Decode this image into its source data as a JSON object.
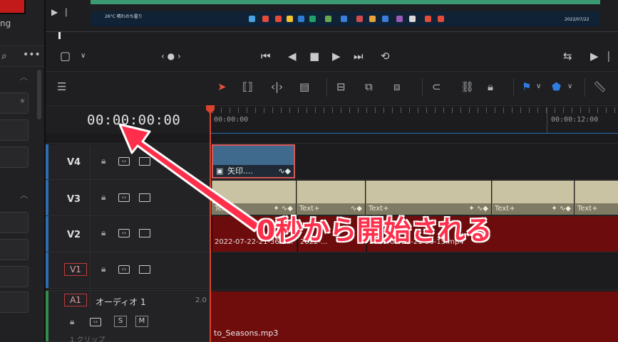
{
  "left_panel": {
    "label": "ng"
  },
  "viewer": {
    "timecode": "00:00:00:00",
    "taskbar_text": "26°C 晴れのち曇り",
    "clock": "2022/07/22"
  },
  "ruler": {
    "start": "00:00:00",
    "mark": "00:00:12:00"
  },
  "tracks": {
    "v4": {
      "name": "V4"
    },
    "v3": {
      "name": "V3"
    },
    "v2": {
      "name": "V2"
    },
    "v1": {
      "name": "V1"
    },
    "a1": {
      "name": "A1",
      "title": "オーディオ 1",
      "level": "2.0",
      "clips": "1 クリップ",
      "solo": "S",
      "mute": "M"
    }
  },
  "clips": {
    "v4_label": "矢印....",
    "v3_labels": [
      "Text+",
      "Text+",
      "Text+",
      "Text+",
      "Text+",
      "Text+"
    ],
    "v2_labels": [
      "2022-07-22-21-36-1...",
      "2022-...",
      "2022-07-22-21-36-15.mp4"
    ],
    "a1_label": "to_Seasons.mp3"
  },
  "annotation": {
    "text": "0秒から開始される",
    "color": "#ff2f4b"
  },
  "colors": {
    "playhead": "#d9432c",
    "video_track": "#3f6a8e",
    "text_clip": "#c9c2a3",
    "audio_clip": "#6f0d0d"
  }
}
